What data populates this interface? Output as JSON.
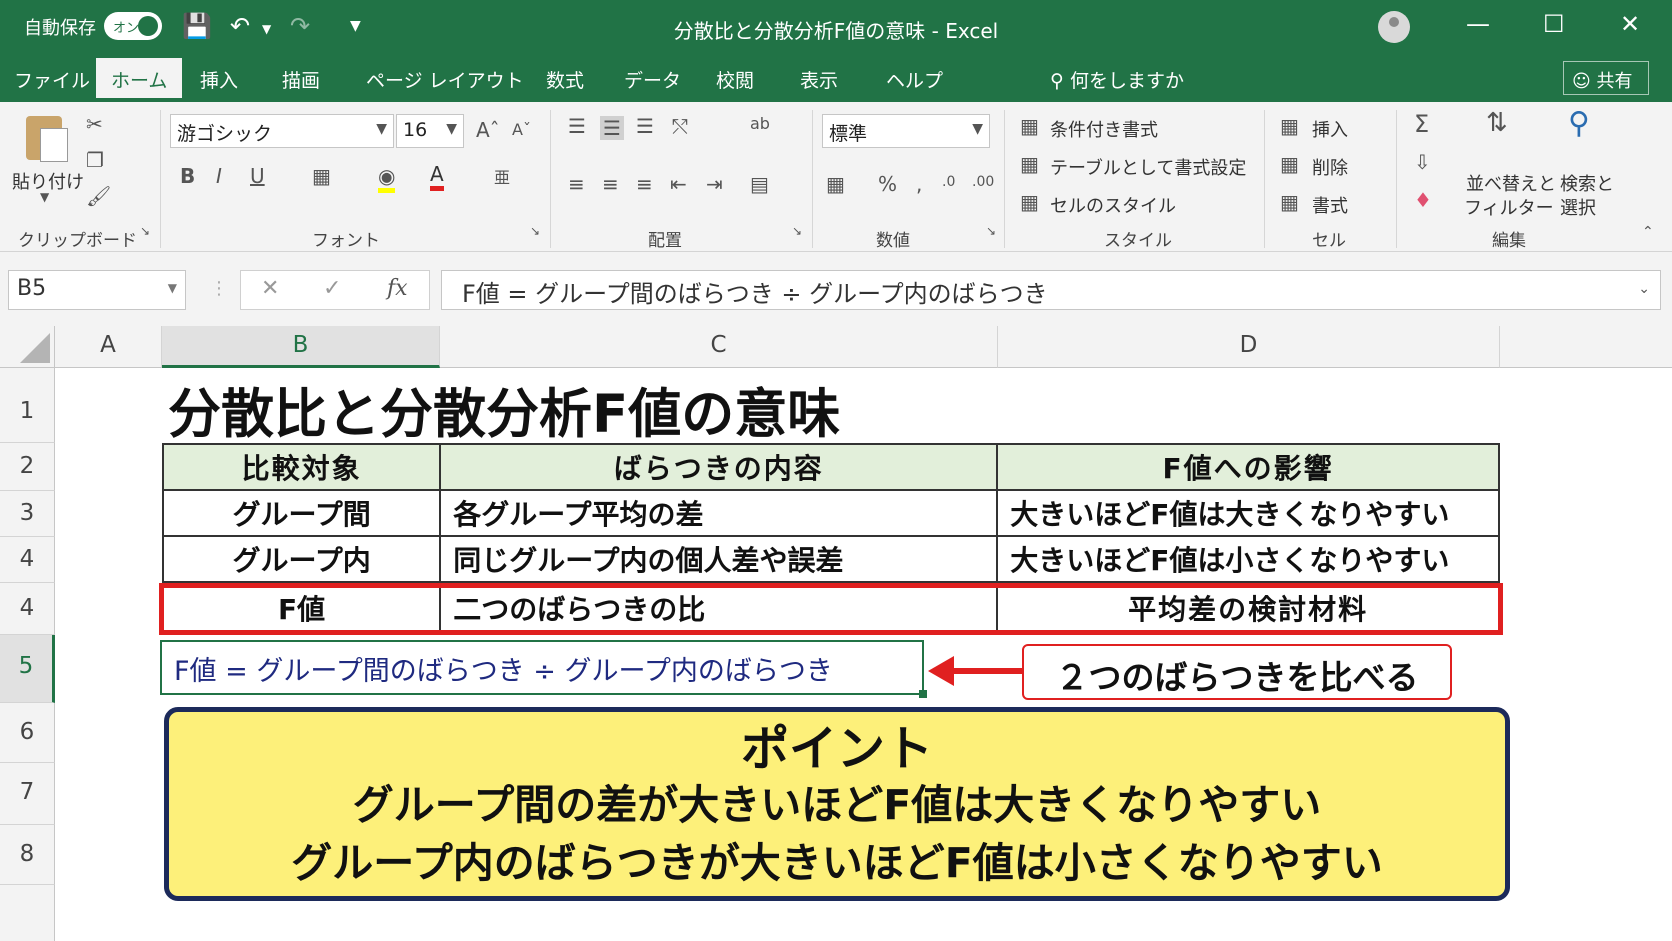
{
  "titlebar": {
    "autosave_label": "自動保存",
    "autosave_state": "オン",
    "window_title": "分散比と分散分析F値の意味 - Excel"
  },
  "menu": {
    "items": [
      "ファイル",
      "ホーム",
      "挿入",
      "描画",
      "ページ レイアウト",
      "数式",
      "データ",
      "校閲",
      "表示",
      "ヘルプ"
    ],
    "active": "ホーム",
    "tell_me": "何をしますか",
    "share": "共有"
  },
  "ribbon": {
    "clipboard": {
      "paste": "貼り付け",
      "label": "クリップボード"
    },
    "font": {
      "name": "游ゴシック",
      "size": "16",
      "label": "フォント"
    },
    "alignment": {
      "label": "配置"
    },
    "number": {
      "format": "標準",
      "label": "数値"
    },
    "styles": {
      "conditional": "条件付き書式",
      "table": "テーブルとして書式設定",
      "cell_styles": "セルのスタイル",
      "label": "スタイル"
    },
    "cells": {
      "insert": "挿入",
      "delete": "削除",
      "format": "書式",
      "label": "セル"
    },
    "editing": {
      "sort1": "並べ替えと",
      "sort2": "フィルター",
      "find1": "検索と",
      "find2": "選択",
      "label": "編集"
    }
  },
  "formula_bar": {
    "name_box": "B5",
    "content": "F値 = グループ間のばらつき ÷ グループ内のばらつき"
  },
  "grid": {
    "columns": [
      "A",
      "B",
      "C",
      "D"
    ],
    "rows": [
      "1",
      "2",
      "3",
      "4",
      "4",
      "5",
      "6",
      "7",
      "8"
    ]
  },
  "sheet": {
    "title": "分散比と分散分析F値の意味",
    "table_headers": [
      "比較対象",
      "ばらつきの内容",
      "F値への影響"
    ],
    "table_rows": [
      [
        "グループ間",
        "各グループ平均の差",
        "大きいほどF値は大きくなりやすい"
      ],
      [
        "グループ内",
        "同じグループ内の個人差や誤差",
        "大きいほどF値は小さくなりやすい"
      ],
      [
        "F値",
        "二つのばらつきの比",
        "平均差の検討材料"
      ]
    ],
    "formula_text": "F値 = グループ間のばらつき ÷ グループ内のばらつき",
    "callout": "２つのばらつきを比べる",
    "point_title": "ポイント",
    "point_line1": "グループ間の差が大きいほどF値は大きくなりやすい",
    "point_line2": "グループ内のばらつきが大きいほどF値は小さくなりやすい"
  },
  "colors": {
    "excel_green": "#217346",
    "highlight_red": "#e02020",
    "point_bg": "#fdf07a",
    "header_bg": "#e2efda"
  }
}
